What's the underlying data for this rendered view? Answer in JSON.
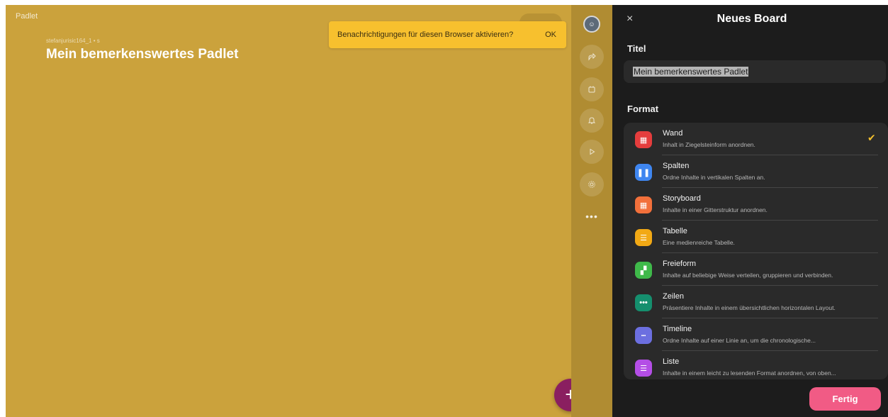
{
  "board": {
    "brand": "Padlet",
    "author": "stefanjurisic164_1 • s",
    "title": "Mein bemerkenswertes Padlet",
    "add_button": "+",
    "bg_color": "#cba23c"
  },
  "notification": {
    "text": "Benachrichtigungen für diesen Browser aktivieren?",
    "ok": "OK"
  },
  "rail": {
    "icons": [
      "share-icon",
      "remix-icon",
      "bell-icon",
      "slideshow-icon",
      "settings-icon",
      "more-icon"
    ],
    "more": "•••"
  },
  "panel": {
    "close": "×",
    "title": "Neues Board",
    "title_label": "Titel",
    "title_value": "Mein bemerkenswertes Padlet",
    "format_label": "Format",
    "done": "Fertig",
    "formats": [
      {
        "name": "Wand",
        "desc": "Inhalt in Ziegelsteinform anordnen.",
        "color": "#e53d3d",
        "selected": true,
        "icon": "wall-icon"
      },
      {
        "name": "Spalten",
        "desc": "Ordne Inhalte in vertikalen Spalten an.",
        "color": "#3f86f0",
        "icon": "columns-icon"
      },
      {
        "name": "Storyboard",
        "desc": "Inhalte in einer Gitterstruktur anordnen.",
        "color": "#f2703b",
        "icon": "grid-icon"
      },
      {
        "name": "Tabelle",
        "desc": "Eine medienreiche Tabelle.",
        "color": "#f2a915",
        "icon": "table-icon"
      },
      {
        "name": "Freieform",
        "desc": "Inhalte auf beliebige Weise verteilen, gruppieren und verbinden.",
        "color": "#3fb94a",
        "icon": "canvas-icon"
      },
      {
        "name": "Zeilen",
        "desc": "Präsentiere Inhalte in einem übersichtlichen horizontalen Layout.",
        "color": "#158f6e",
        "icon": "rows-icon"
      },
      {
        "name": "Timeline",
        "desc": "Ordne Inhalte auf einer Linie an, um die chronologische...",
        "color": "#6c6fe0",
        "icon": "timeline-icon"
      },
      {
        "name": "Liste",
        "desc": "Inhalte in einem leicht zu lesenden Format anordnen, von oben...",
        "color": "#b44ee6",
        "icon": "list-icon"
      }
    ],
    "check_mark": "✔",
    "accent": "#f15b85"
  }
}
